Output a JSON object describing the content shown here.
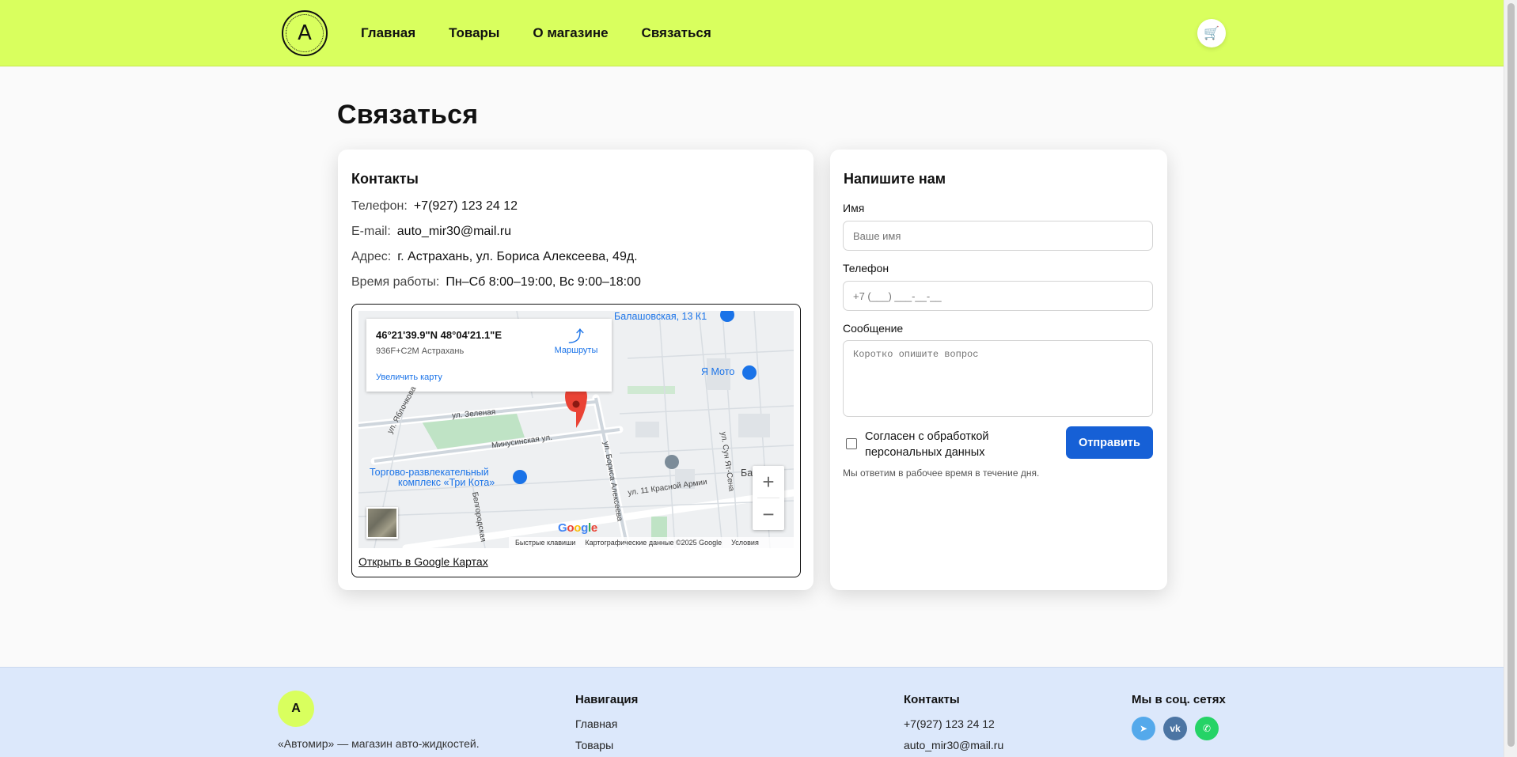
{
  "header": {
    "logo_letter": "A",
    "nav": [
      "Главная",
      "Товары",
      "О магазине",
      "Связаться"
    ],
    "cart_icon": "🛒"
  },
  "page": {
    "title": "Связаться"
  },
  "contacts": {
    "title": "Контакты",
    "rows": [
      {
        "label": "Телефон:",
        "value": "+7(927) 123 24 12"
      },
      {
        "label": "E-mail:",
        "value": "auto_mir30@mail.ru"
      },
      {
        "label": "Адрес:",
        "value": "г. Астрахань, ул. Бориса Алексеева, 49д."
      },
      {
        "label": "Время работы:",
        "value": "Пн–Сб 8:00–19:00, Вс 9:00–18:00"
      }
    ],
    "map": {
      "coords": "46°21'39.9\"N 48°04'21.1\"E",
      "plus_code": "936F+C2M Астрахань",
      "enlarge": "Увеличить карту",
      "routes": "Маршруты",
      "zoom_in": "+",
      "zoom_out": "−",
      "labels": {
        "balash": "Балашовская, 13 К1",
        "moto": "Я Мото",
        "trc1": "Торгово-развлекательный",
        "trc2": "комплекс «Три Кота»",
        "zelen": "ул. Зеленая",
        "minus": "Минусинская ул.",
        "yabl": "ул. Яблочкова",
        "boris": "ул. Бориса Алексеева",
        "kras": "ул. 11 Красной Армии",
        "sun": "ул. Сун Ят-Сена",
        "belg": "Белгородская",
        "ba": "Ба"
      },
      "footer": {
        "keys": "Быстрые клавиши",
        "data": "Картографические данные ©2025 Google",
        "terms": "Условия"
      },
      "open_link": "Открыть в Google Картах"
    }
  },
  "form": {
    "title": "Напишите нам",
    "name_label": "Имя",
    "name_placeholder": "Ваше имя",
    "phone_label": "Телефон",
    "phone_placeholder": "+7 (___) ___-__-__",
    "message_label": "Сообщение",
    "message_placeholder": "Коротко опишите вопрос",
    "consent": "Согласен с обработкой персональных данных",
    "submit": "Отправить",
    "note": "Мы ответим в рабочее время в течение дня."
  },
  "footer": {
    "logo_letter": "A",
    "description": "«Автомир» — магазин авто-жидкостей.",
    "nav_title": "Навигация",
    "nav_links": [
      "Главная",
      "Товары"
    ],
    "contacts_title": "Контакты",
    "contacts": [
      "+7(927) 123 24 12",
      "auto_mir30@mail.ru"
    ],
    "social_title": "Мы в соц. сетях",
    "social_colors": {
      "telegram": "#54a9eb",
      "vk": "#4c75a3",
      "whatsapp": "#25d366"
    }
  },
  "colors": {
    "header_bg": "#d9ff5e",
    "accent": "#1660d6",
    "footer_bg": "#dce8fb"
  }
}
